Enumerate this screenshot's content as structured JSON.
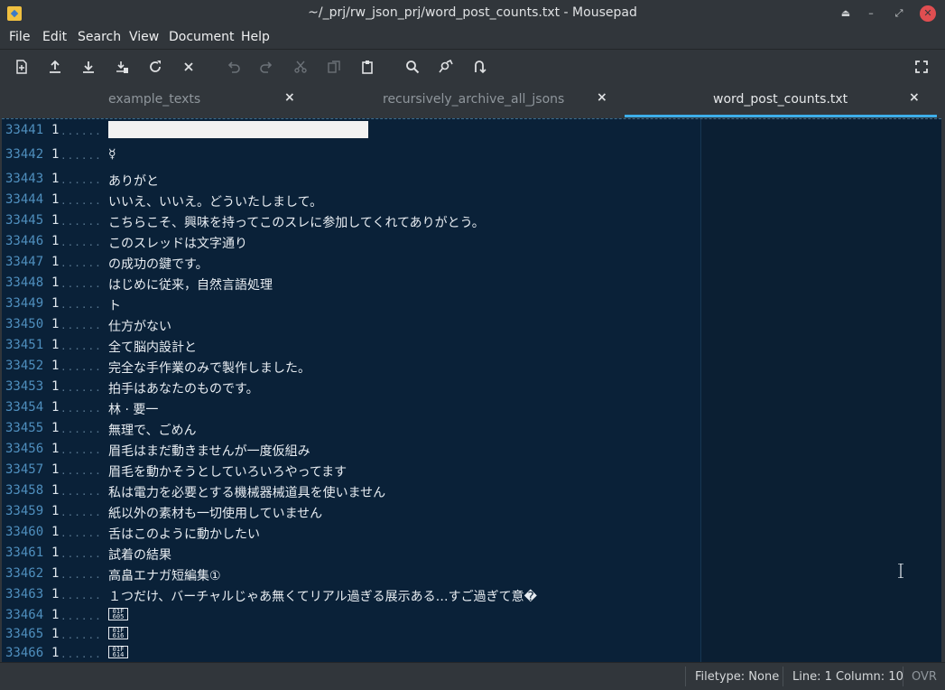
{
  "window": {
    "title": "~/_prj/rw_json_prj/word_post_counts.txt - Mousepad",
    "close_glyph": "✕",
    "minimize_glyph": "–",
    "restore_glyph": "⤢",
    "shade_glyph": "⏏"
  },
  "menu": [
    "File",
    "Edit",
    "Search",
    "View",
    "Document",
    "Help"
  ],
  "toolbar": {
    "icons": [
      "new-document-icon",
      "open-icon",
      "save-icon",
      "save-as-icon",
      "reload-icon",
      "close-document-icon",
      "undo-icon",
      "redo-icon",
      "cut-icon",
      "copy-icon",
      "paste-icon",
      "find-icon",
      "find-replace-icon",
      "goto-line-icon",
      "fullscreen-icon"
    ]
  },
  "tabs": [
    {
      "label": "example_texts",
      "close": "×",
      "active": false
    },
    {
      "label": "recursively_archive_all_jsons",
      "close": "×",
      "active": false
    },
    {
      "label": "word_post_counts.txt",
      "close": "×",
      "active": true
    }
  ],
  "editor": {
    "dots": "......",
    "lines": [
      {
        "num": "33441",
        "count": "1",
        "text": "",
        "kind": "block"
      },
      {
        "num": "33442",
        "count": "1",
        "text": "☿",
        "kind": "text"
      },
      {
        "num": "33443",
        "count": "1",
        "text": "ありがと",
        "kind": "text"
      },
      {
        "num": "33444",
        "count": "1",
        "text": "いいえ、いいえ。どういたしまして。",
        "kind": "text"
      },
      {
        "num": "33445",
        "count": "1",
        "text": "こちらこそ、興味を持ってこのスレに参加してくれてありがとう。",
        "kind": "text"
      },
      {
        "num": "33446",
        "count": "1",
        "text": "このスレッドは文字通り",
        "kind": "text"
      },
      {
        "num": "33447",
        "count": "1",
        "text": "の成功の鍵です。",
        "kind": "text"
      },
      {
        "num": "33448",
        "count": "1",
        "text": "はじめに従来，自然言語処理",
        "kind": "text"
      },
      {
        "num": "33449",
        "count": "1",
        "text": "ト",
        "kind": "text"
      },
      {
        "num": "33450",
        "count": "1",
        "text": "仕方がない",
        "kind": "text"
      },
      {
        "num": "33451",
        "count": "1",
        "text": "全て脳内設計と",
        "kind": "text"
      },
      {
        "num": "33452",
        "count": "1",
        "text": "完全な手作業のみで製作しました。",
        "kind": "text"
      },
      {
        "num": "33453",
        "count": "1",
        "text": "拍手はあなたのものです。",
        "kind": "text"
      },
      {
        "num": "33454",
        "count": "1",
        "text": "林 · 要一",
        "kind": "text"
      },
      {
        "num": "33455",
        "count": "1",
        "text": "無理で、ごめん",
        "kind": "text"
      },
      {
        "num": "33456",
        "count": "1",
        "text": "眉毛はまだ動きませんが一度仮組み",
        "kind": "text"
      },
      {
        "num": "33457",
        "count": "1",
        "text": "眉毛を動かそうとしていろいろやってます",
        "kind": "text"
      },
      {
        "num": "33458",
        "count": "1",
        "text": "私は電力を必要とする機械器械道具を使いません",
        "kind": "text"
      },
      {
        "num": "33459",
        "count": "1",
        "text": "紙以外の素材も一切使用していません",
        "kind": "text"
      },
      {
        "num": "33460",
        "count": "1",
        "text": "舌はこのように動かしたい",
        "kind": "text"
      },
      {
        "num": "33461",
        "count": "1",
        "text": "試着の結果",
        "kind": "text"
      },
      {
        "num": "33462",
        "count": "1",
        "text": "高畠エナガ短編集①",
        "kind": "text"
      },
      {
        "num": "33463",
        "count": "1",
        "text": "１つだけ、バーチャルじゃあ無くてリアル過ぎる展示ある…すご過ぎて意�",
        "kind": "text"
      },
      {
        "num": "33464",
        "count": "1",
        "text": "01F\n605",
        "kind": "box"
      },
      {
        "num": "33465",
        "count": "1",
        "text": "01F\n616",
        "kind": "box"
      },
      {
        "num": "33466",
        "count": "1",
        "text": "01F\n614",
        "kind": "box"
      }
    ]
  },
  "status": {
    "filetype": "Filetype: None",
    "position": "Line: 1 Column: 10",
    "mode": "OVR"
  }
}
